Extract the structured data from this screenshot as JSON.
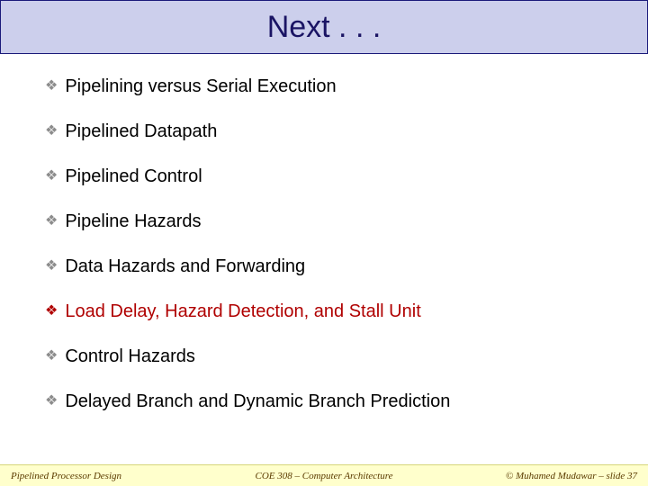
{
  "title": "Next . . .",
  "bullets": [
    {
      "text": "Pipelining versus Serial Execution",
      "highlight": false
    },
    {
      "text": "Pipelined Datapath",
      "highlight": false
    },
    {
      "text": "Pipelined Control",
      "highlight": false
    },
    {
      "text": "Pipeline Hazards",
      "highlight": false
    },
    {
      "text": "Data Hazards and Forwarding",
      "highlight": false
    },
    {
      "text": "Load Delay, Hazard Detection, and Stall Unit",
      "highlight": true
    },
    {
      "text": "Control Hazards",
      "highlight": false
    },
    {
      "text": "Delayed Branch and Dynamic Branch Prediction",
      "highlight": false
    }
  ],
  "footer": {
    "left": "Pipelined Processor Design",
    "center": "COE 308 – Computer Architecture",
    "right": "© Muhamed Mudawar – slide 37"
  },
  "bullet_glyph": "❖"
}
